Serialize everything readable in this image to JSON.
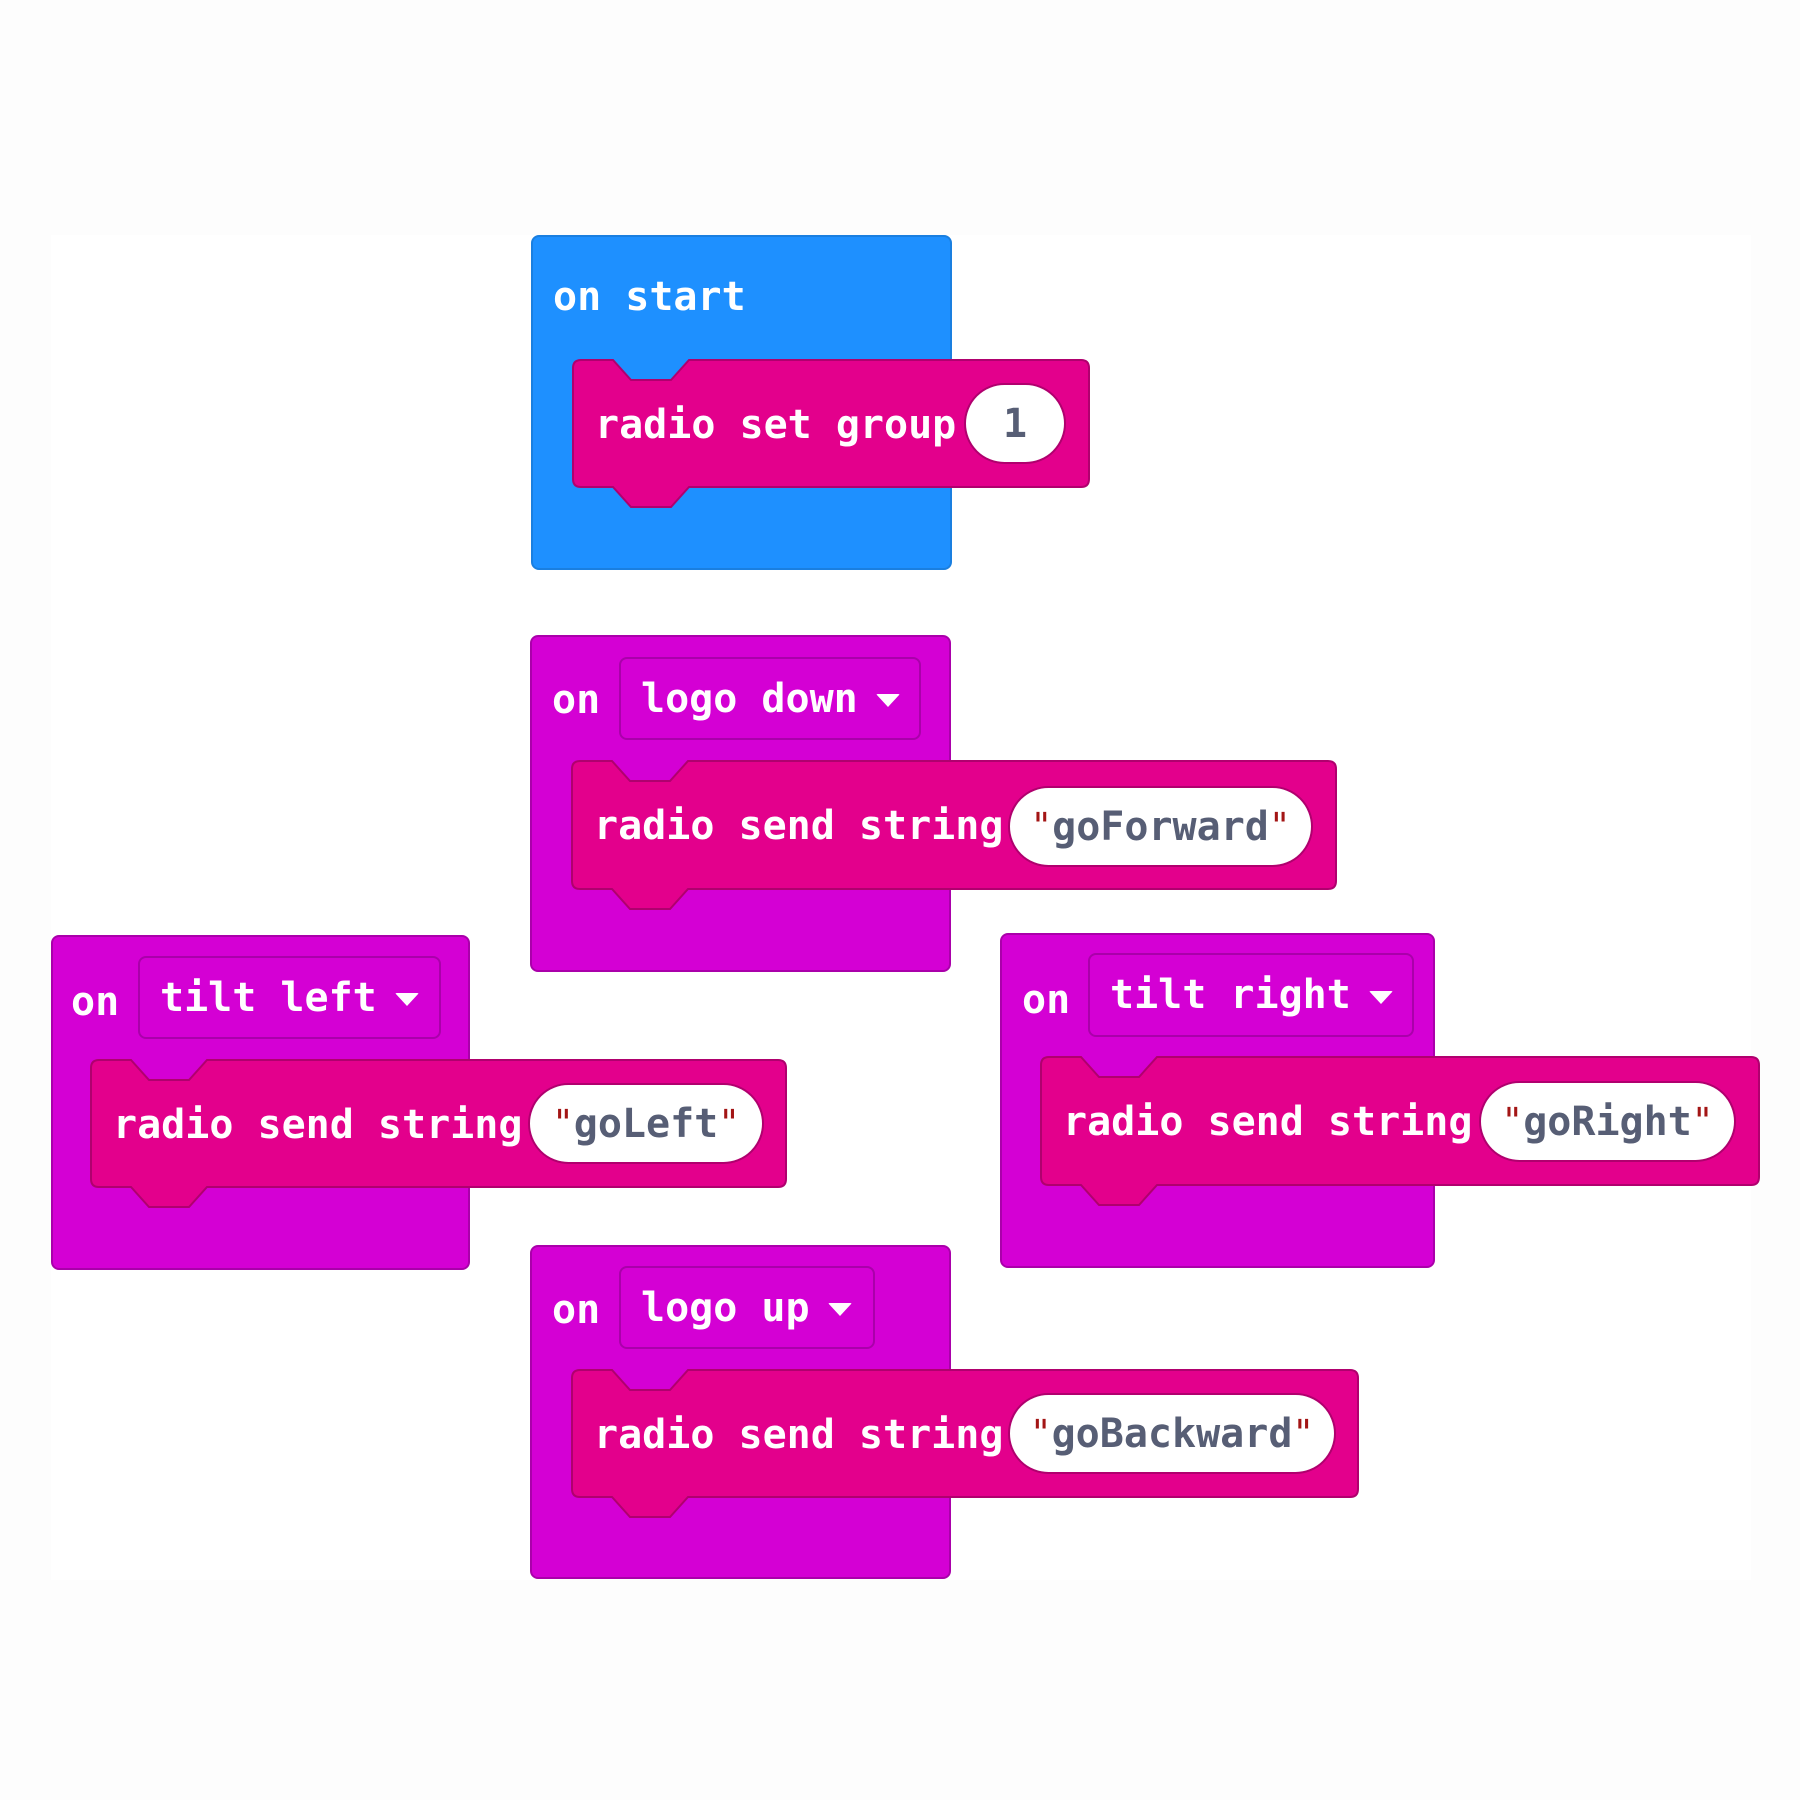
{
  "colors": {
    "basic_blue": "#1e90ff",
    "input_purple": "#d400d4",
    "radio_magenta": "#e3008c",
    "string_text": "#575e75",
    "quote_red": "#a31515"
  },
  "blocks": {
    "on_start": {
      "label": "on start",
      "child": {
        "label": "radio set group",
        "value": "1"
      }
    },
    "logo_down": {
      "prefix": "on",
      "dropdown": "logo down",
      "child": {
        "label": "radio send string",
        "open_quote": "\"",
        "value": "goForward",
        "close_quote": "\""
      }
    },
    "tilt_left": {
      "prefix": "on",
      "dropdown": "tilt left",
      "child": {
        "label": "radio send string",
        "open_quote": "\"",
        "value": "goLeft",
        "close_quote": "\""
      }
    },
    "tilt_right": {
      "prefix": "on",
      "dropdown": "tilt right",
      "child": {
        "label": "radio send string",
        "open_quote": "\"",
        "value": "goRight",
        "close_quote": "\""
      }
    },
    "logo_up": {
      "prefix": "on",
      "dropdown": "logo up",
      "child": {
        "label": "radio send string",
        "open_quote": "\"",
        "value": "goBackward",
        "close_quote": "\""
      }
    }
  }
}
